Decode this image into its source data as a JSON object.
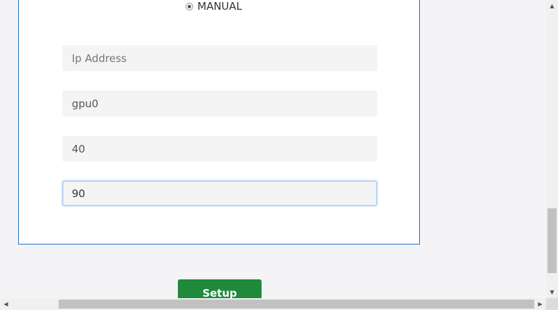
{
  "form": {
    "mode_option": "MANUAL",
    "fields": [
      {
        "value": "",
        "placeholder": "Ip Address"
      },
      {
        "value": "gpu0",
        "placeholder": ""
      },
      {
        "value": "40",
        "placeholder": ""
      },
      {
        "value": "90",
        "placeholder": ""
      }
    ],
    "setup_label": "Setup"
  },
  "scrollbars": {
    "up_arrow": "▲",
    "down_arrow": "▼",
    "left_arrow": "◀",
    "right_arrow": "▶"
  },
  "colors": {
    "panel_border": "#1d6fc4",
    "button": "#1f8a3b",
    "field_bg": "#f4f4f4",
    "focus_ring": "#bcd6f4"
  }
}
